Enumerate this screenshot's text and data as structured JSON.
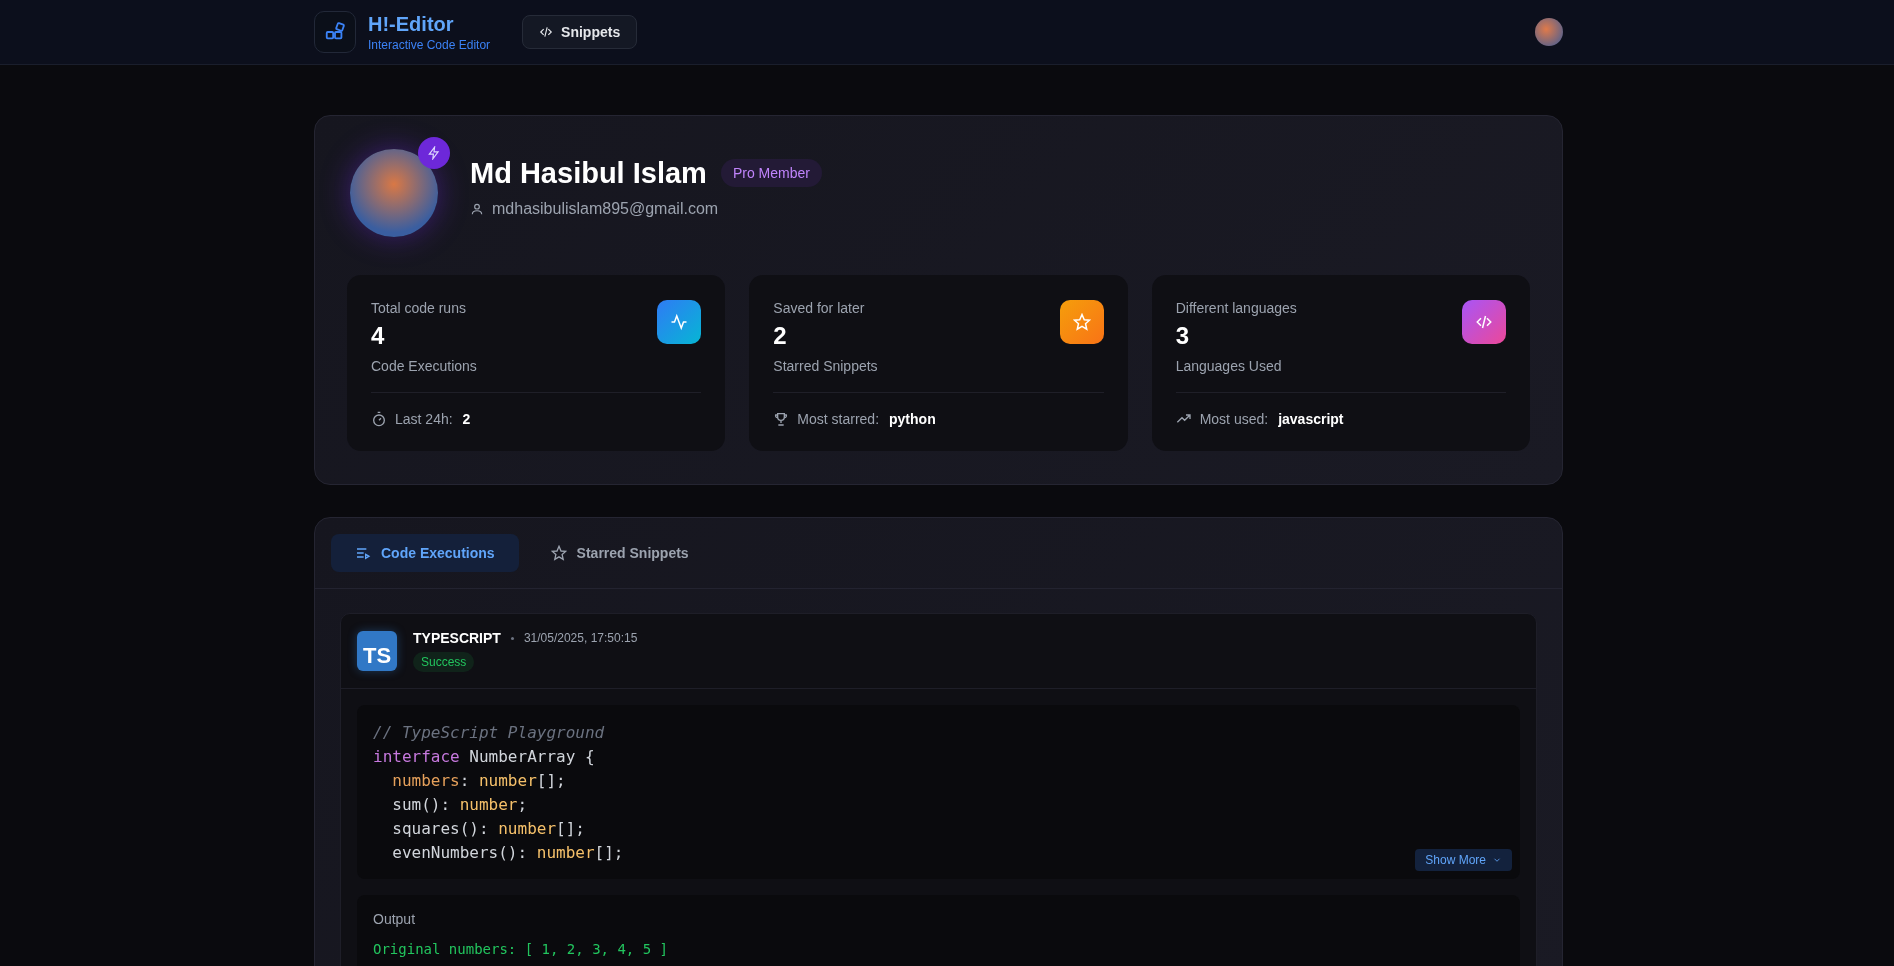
{
  "header": {
    "brand": "H!-Editor",
    "tagline": "Interactive Code Editor",
    "nav": [
      {
        "label": "Snippets"
      }
    ]
  },
  "profile": {
    "name": "Md Hasibul Islam",
    "badge": "Pro Member",
    "email": "mdhasibulislam895@gmail.com",
    "stats": [
      {
        "kind": "runs",
        "title": "Total code runs",
        "value": "4",
        "caption": "Code Executions",
        "footer_label": "Last 24h:",
        "footer_value": "2"
      },
      {
        "kind": "starred",
        "title": "Saved for later",
        "value": "2",
        "caption": "Starred Snippets",
        "footer_label": "Most starred:",
        "footer_value": "python"
      },
      {
        "kind": "languages",
        "title": "Different languages",
        "value": "3",
        "caption": "Languages Used",
        "footer_label": "Most used:",
        "footer_value": "javascript"
      }
    ]
  },
  "tabs": [
    {
      "kind": "executions",
      "label": "Code Executions",
      "selected": true
    },
    {
      "kind": "starred",
      "label": "Starred Snippets",
      "selected": false
    }
  ],
  "execution": {
    "language_badge": "TS",
    "language": "TYPESCRIPT",
    "time": "31/05/2025, 17:50:15",
    "status": "Success",
    "code": [
      [
        {
          "kind": "comment",
          "text": "// TypeScript Playground"
        }
      ],
      [
        {
          "kind": "keyword",
          "text": "interface"
        },
        {
          "kind": "plain",
          "text": " NumberArray {"
        }
      ],
      [
        {
          "kind": "property",
          "text": "numbers",
          "indented": true
        },
        {
          "kind": "plain",
          "text": ": "
        },
        {
          "kind": "type",
          "text": "number"
        },
        {
          "kind": "plain",
          "text": "[];"
        }
      ],
      [
        {
          "kind": "plain",
          "text": "sum(): ",
          "indented": true
        },
        {
          "kind": "type",
          "text": "number"
        },
        {
          "kind": "plain",
          "text": ";"
        }
      ],
      [
        {
          "kind": "plain",
          "text": "squares(): ",
          "indented": true
        },
        {
          "kind": "type",
          "text": "number"
        },
        {
          "kind": "plain",
          "text": "[];"
        }
      ],
      [
        {
          "kind": "plain",
          "text": "evenNumbers(): ",
          "indented": true
        },
        {
          "kind": "type",
          "text": "number"
        },
        {
          "kind": "plain",
          "text": "[];"
        }
      ]
    ],
    "show_more": "Show More",
    "output_label": "Output",
    "output_lines": [
      "Original numbers: [ 1, 2, 3, 4, 5 ]"
    ]
  }
}
